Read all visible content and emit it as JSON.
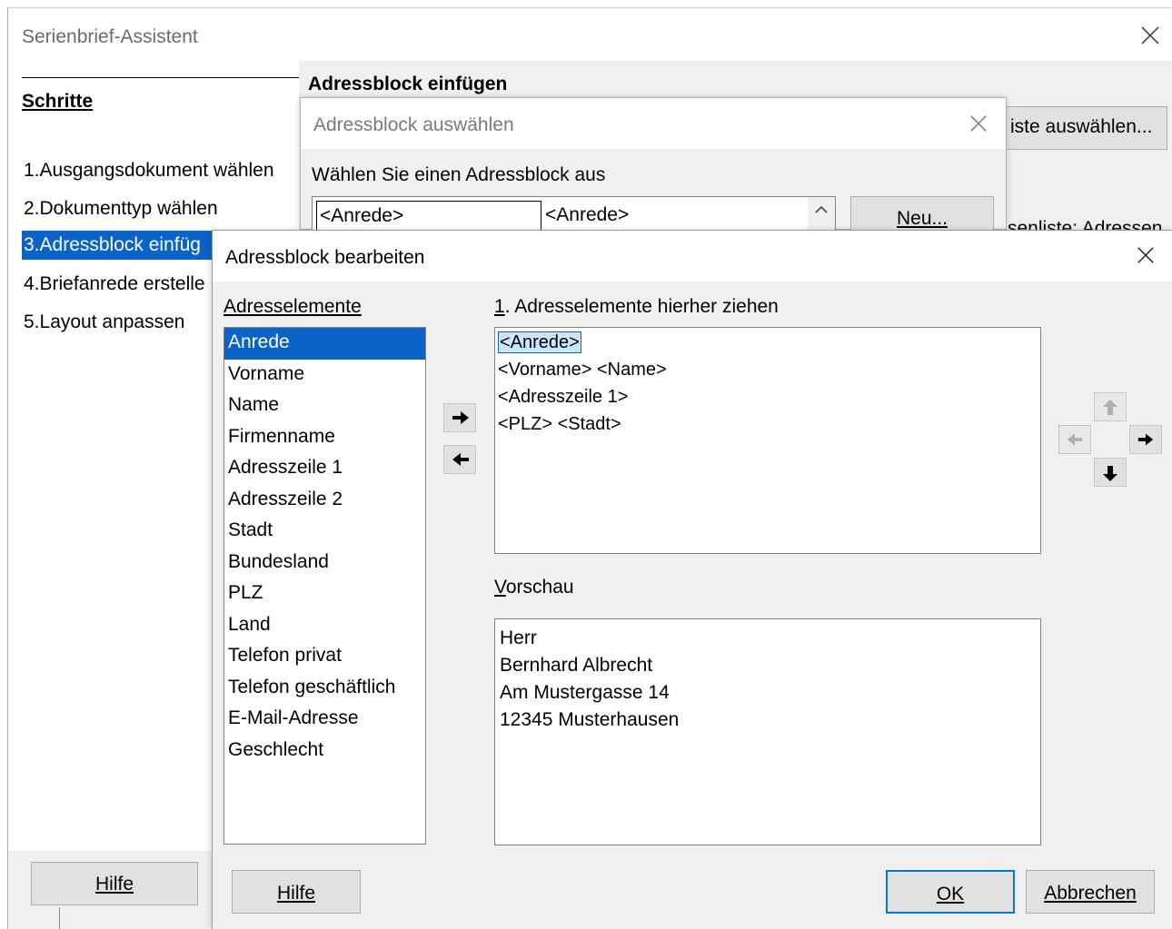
{
  "wizard": {
    "title": "Serienbrief-Assistent",
    "steps_heading": "Schritte",
    "steps": [
      {
        "label": "1.Ausgangsdokument wählen"
      },
      {
        "label": "2.Dokumenttyp wählen"
      },
      {
        "label": "3.Adressblock einfüg"
      },
      {
        "label": "4.Briefanrede erstelle"
      },
      {
        "label": "5.Layout anpassen"
      }
    ],
    "right_heading": "Adressblock einfügen",
    "list_button": "iste auswählen...",
    "partial_text": "senliste: Adressen",
    "help_button": "Hilfe"
  },
  "select_dialog": {
    "title": "Adressblock auswählen",
    "label": "Wählen Sie einen Adressblock aus",
    "cells": [
      "<Anrede>",
      "<Anrede>"
    ],
    "new_button": "Neu..."
  },
  "edit_dialog": {
    "title": "Adressblock bearbeiten",
    "elements_label": "Adresselemente",
    "elements": [
      "Anrede",
      "Vorname",
      "Name",
      "Firmenname",
      "Adresszeile 1",
      "Adresszeile 2",
      "Stadt",
      "Bundesland",
      "PLZ",
      "Land",
      "Telefon privat",
      "Telefon geschäftlich",
      "E-Mail-Adresse",
      "Geschlecht"
    ],
    "selected_element": "Anrede",
    "drag_label": "1. Adresselemente hierher ziehen",
    "drag_lines": [
      "<Anrede>",
      "<Vorname> <Name>",
      "<Adresszeile 1>",
      "<PLZ> <Stadt>"
    ],
    "preview_label": "Vorschau",
    "preview_lines": [
      "Herr",
      "Bernhard Albrecht",
      "Am Mustergasse 14",
      "12345 Musterhausen"
    ],
    "buttons": {
      "help": "Hilfe",
      "ok": "OK",
      "cancel": "Abbrechen"
    }
  },
  "icons": [
    "close-icon",
    "arrow-right-icon",
    "arrow-left-icon",
    "arrow-up-icon",
    "arrow-down-icon",
    "scroll-up-icon"
  ],
  "colors": {
    "selection": "#0a64c8",
    "dialog_bg": "#f0f0f0",
    "button_bg": "#e1e1e1",
    "default_border": "#0078d7"
  }
}
